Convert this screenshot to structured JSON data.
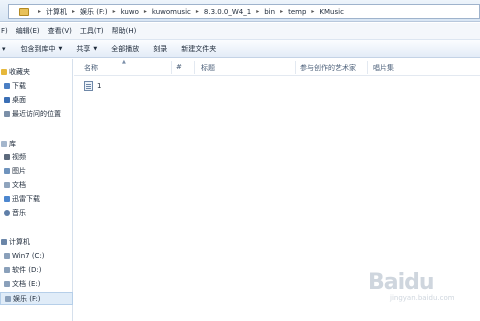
{
  "address": {
    "crumbs": [
      "计算机",
      "娱乐 (F:)",
      "kuwo",
      "kuwomusic",
      "8.3.0.0_W4_1",
      "bin",
      "temp",
      "KMusic"
    ]
  },
  "menu": [
    "F)",
    "编辑(E)",
    "查看(V)",
    "工具(T)",
    "帮助(H)"
  ],
  "toolbar": {
    "organize": "▾",
    "include_in_library": "包含到库中",
    "share": "共享",
    "play_all": "全部播放",
    "burn": "刻录",
    "new_folder": "新建文件夹"
  },
  "nav": {
    "favorites_header": "收藏夹",
    "favorites": [
      "下载",
      "桌面",
      "最近访问的位置"
    ],
    "libraries_header": "库",
    "libraries": [
      "视频",
      "图片",
      "文档",
      "迅雷下载",
      "音乐"
    ],
    "computer_header": "计算机",
    "drives": [
      "Win7 (C:)",
      "软件 (D:)",
      "文档 (E:)",
      "娱乐 (F:)"
    ]
  },
  "columns": {
    "name": "名称",
    "number": "#",
    "title": "标题",
    "artists": "参与创作的艺术家",
    "album": "唱片集"
  },
  "files": [
    {
      "name": "1"
    }
  ],
  "watermark": {
    "logo": "Baidu",
    "sub": "jingyan.baidu.com"
  }
}
